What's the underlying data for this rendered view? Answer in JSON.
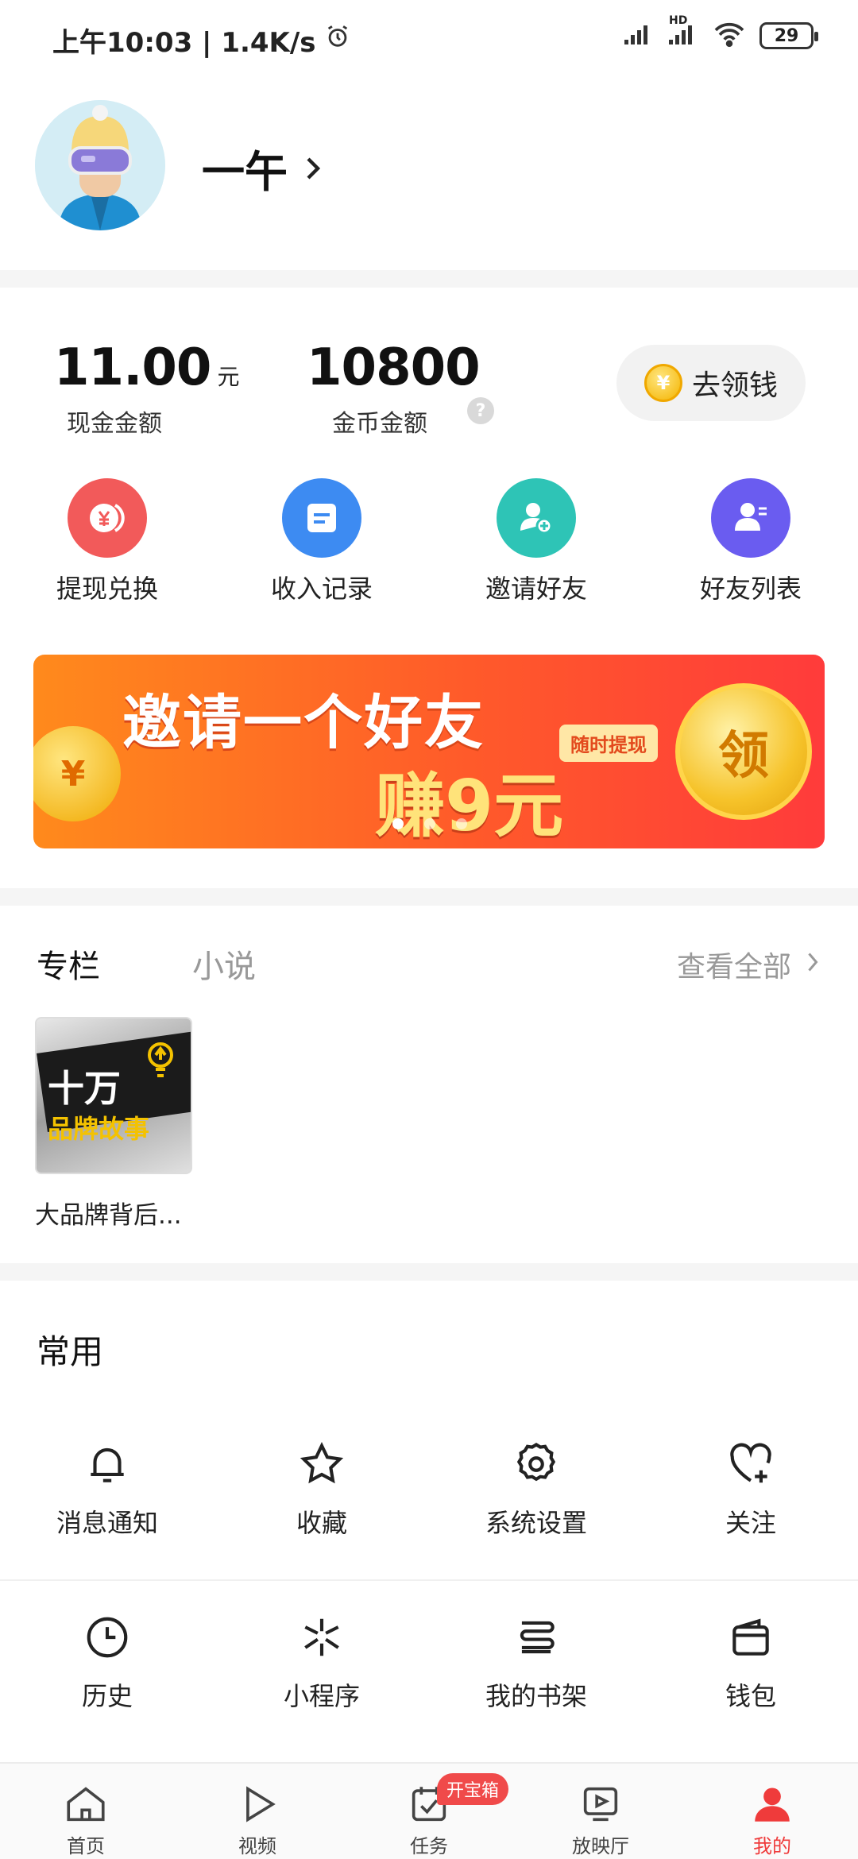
{
  "status_bar": {
    "time_speed": "上午10:03 | 1.4K/s",
    "battery": "29",
    "network_label": "HD"
  },
  "profile": {
    "name": "一午"
  },
  "earnings": {
    "cash_value": "11.00",
    "cash_unit": "元",
    "cash_label": "现金金额",
    "coin_value": "10800",
    "coin_label": "金币金额",
    "help_glyph": "?",
    "claim_button": "去领钱",
    "claim_coin_glyph": "¥"
  },
  "quick_actions": [
    {
      "label": "提现兑换",
      "icon": "yuan-exchange-icon",
      "color": "#f25a5a"
    },
    {
      "label": "收入记录",
      "icon": "record-icon",
      "color": "#3d8bf2"
    },
    {
      "label": "邀请好友",
      "icon": "invite-user-icon",
      "color": "#2ec4b6"
    },
    {
      "label": "好友列表",
      "icon": "friend-list-icon",
      "color": "#6a5cf0"
    }
  ],
  "banner": {
    "title": "邀请一个好友",
    "subtitle": "赚9元",
    "tag": "随时提现",
    "coin_text": "领",
    "left_coin_glyph": "¥",
    "slide_count": 3,
    "active_slide": 0
  },
  "column": {
    "tab_active": "专栏",
    "tab_inactive": "小说",
    "view_all": "查看全部",
    "book_cover_line1": "十万",
    "book_cover_line2": "品牌故事",
    "book_title": "大品牌背后..."
  },
  "common": {
    "title": "常用",
    "items": [
      {
        "label": "消息通知",
        "icon": "bell-icon"
      },
      {
        "label": "收藏",
        "icon": "star-icon"
      },
      {
        "label": "系统设置",
        "icon": "gear-icon"
      },
      {
        "label": "关注",
        "icon": "heart-plus-icon"
      },
      {
        "label": "历史",
        "icon": "clock-icon"
      },
      {
        "label": "小程序",
        "icon": "mini-program-icon"
      },
      {
        "label": "我的书架",
        "icon": "bookshelf-icon"
      },
      {
        "label": "钱包",
        "icon": "wallet-icon"
      }
    ]
  },
  "bottom_nav": {
    "items": [
      {
        "label": "首页",
        "icon": "home-icon"
      },
      {
        "label": "视频",
        "icon": "play-icon"
      },
      {
        "label": "任务",
        "icon": "task-icon"
      },
      {
        "label": "放映厅",
        "icon": "screening-icon"
      },
      {
        "label": "我的",
        "icon": "profile-icon"
      }
    ],
    "active_index": 4,
    "task_badge": "开宝箱",
    "active_color": "#ef3b3b"
  }
}
